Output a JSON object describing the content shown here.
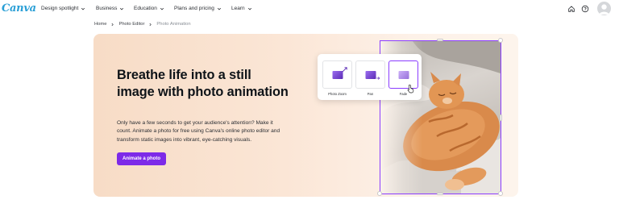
{
  "nav": {
    "logo": "Canva",
    "menu": [
      {
        "label": "Design spotlight"
      },
      {
        "label": "Business"
      },
      {
        "label": "Education"
      },
      {
        "label": "Plans and pricing"
      },
      {
        "label": "Learn"
      }
    ],
    "icons": [
      "home-icon",
      "help-icon",
      "avatar"
    ]
  },
  "breadcrumb": {
    "items": [
      "Home",
      "Photo Editor"
    ],
    "current": "Photo Animation"
  },
  "hero": {
    "title": "Breathe life into a still image with photo animation",
    "description": "Only have a few seconds to get your audience's attention? Make it count. Animate a photo for free using Canva's online photo editor and transform static images into vibrant, eye-catching visuals.",
    "cta_label": "Animate a photo"
  },
  "animation_options": [
    {
      "label": "Photo Zoom",
      "selected": false
    },
    {
      "label": "Pan",
      "selected": false
    },
    {
      "label": "Fade",
      "selected": true
    }
  ],
  "colors": {
    "brand_purple": "#7d2ae8",
    "selection_purple": "#8b3dff",
    "logo_blue": "#2a9fd6",
    "hero_bg": "#f9e2d0"
  }
}
